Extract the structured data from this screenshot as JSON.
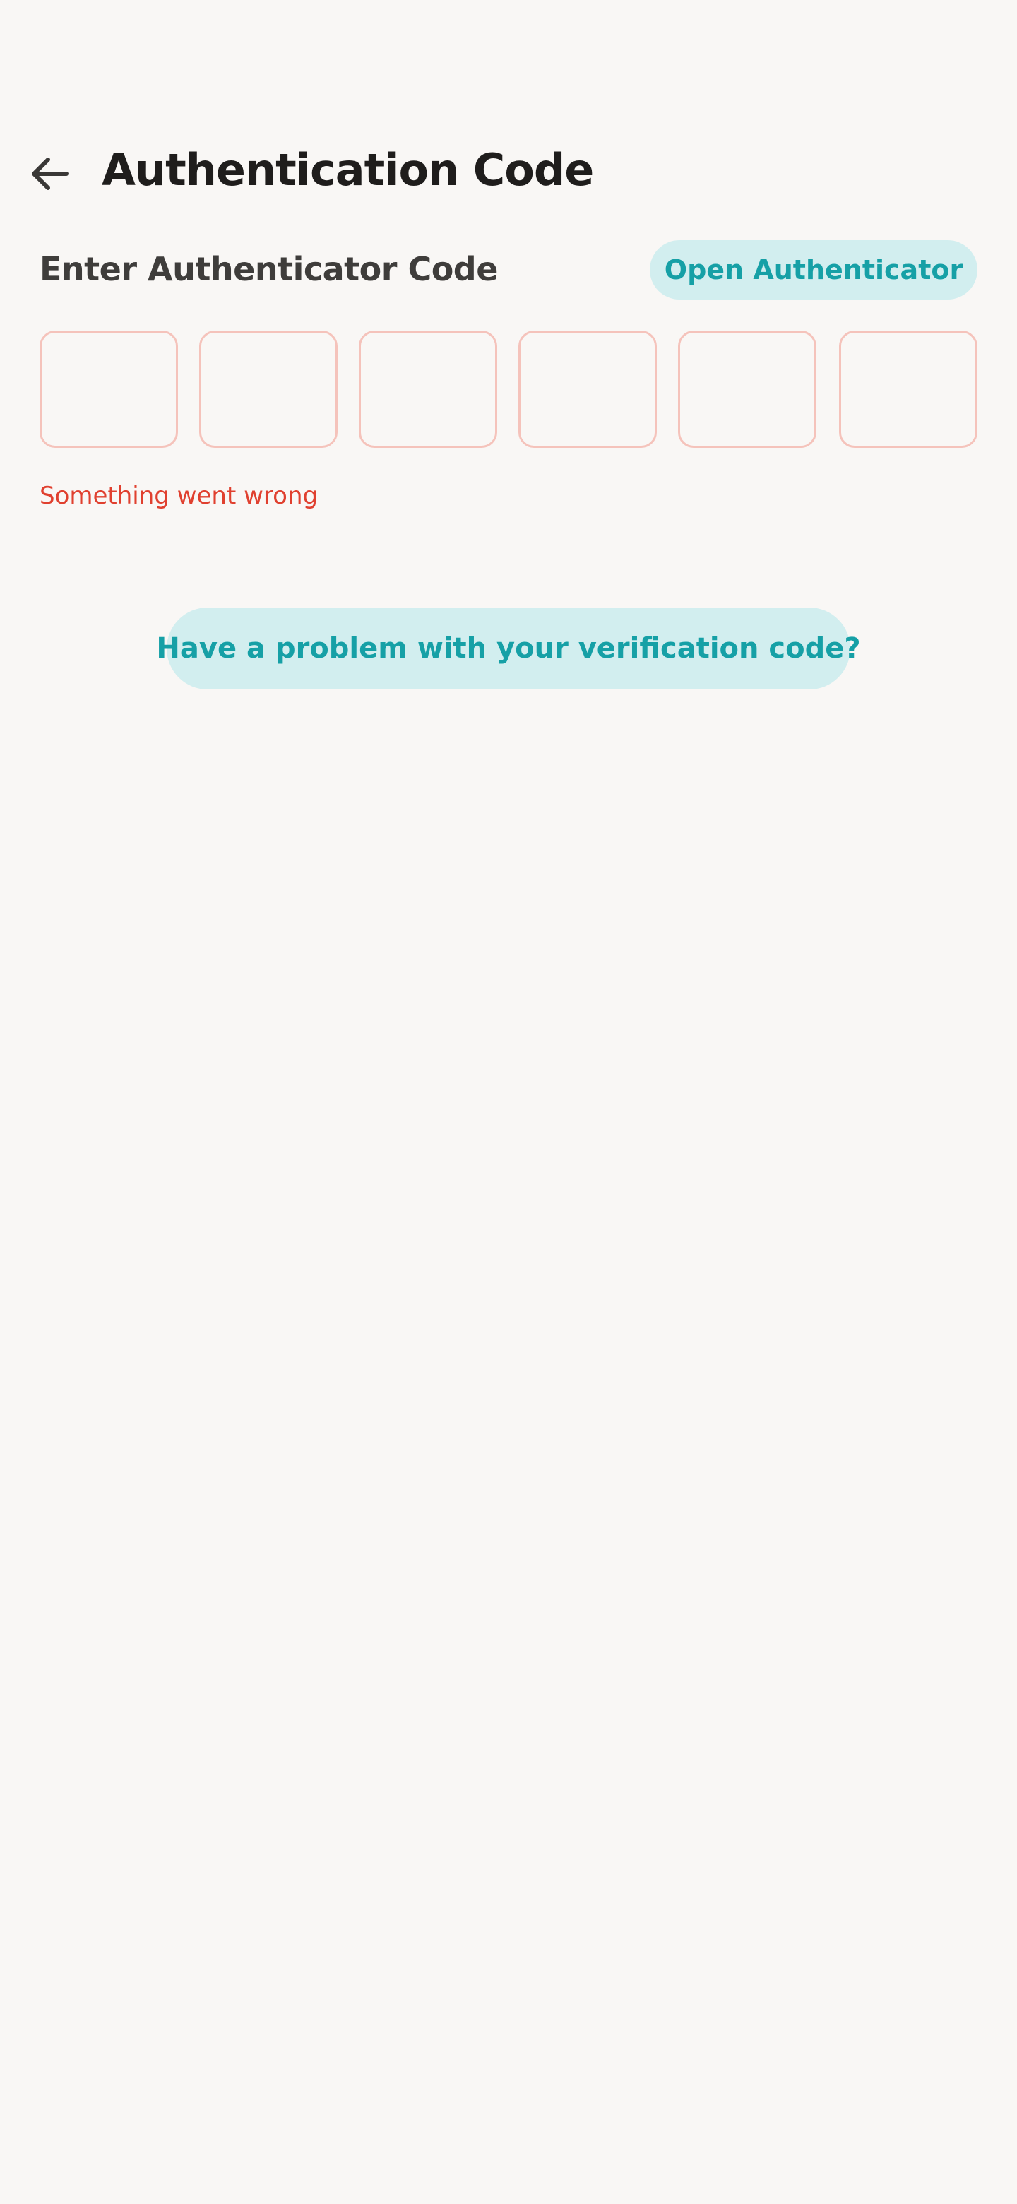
{
  "header": {
    "back_icon": "arrow-left-icon",
    "title": "Authentication Code"
  },
  "code_section": {
    "label": "Enter Authenticator Code",
    "open_button_label": "Open Authenticator",
    "digits": [
      "",
      "",
      "",
      "",
      "",
      ""
    ],
    "error": "Something went wrong"
  },
  "help": {
    "button_label": "Have a problem with your verification code?"
  },
  "colors": {
    "background": "#f9f7f5",
    "accent": "#16a0a6",
    "accent_bg": "#d2eeef",
    "error": "#e0402f",
    "box_border": "#f5c3bb"
  }
}
